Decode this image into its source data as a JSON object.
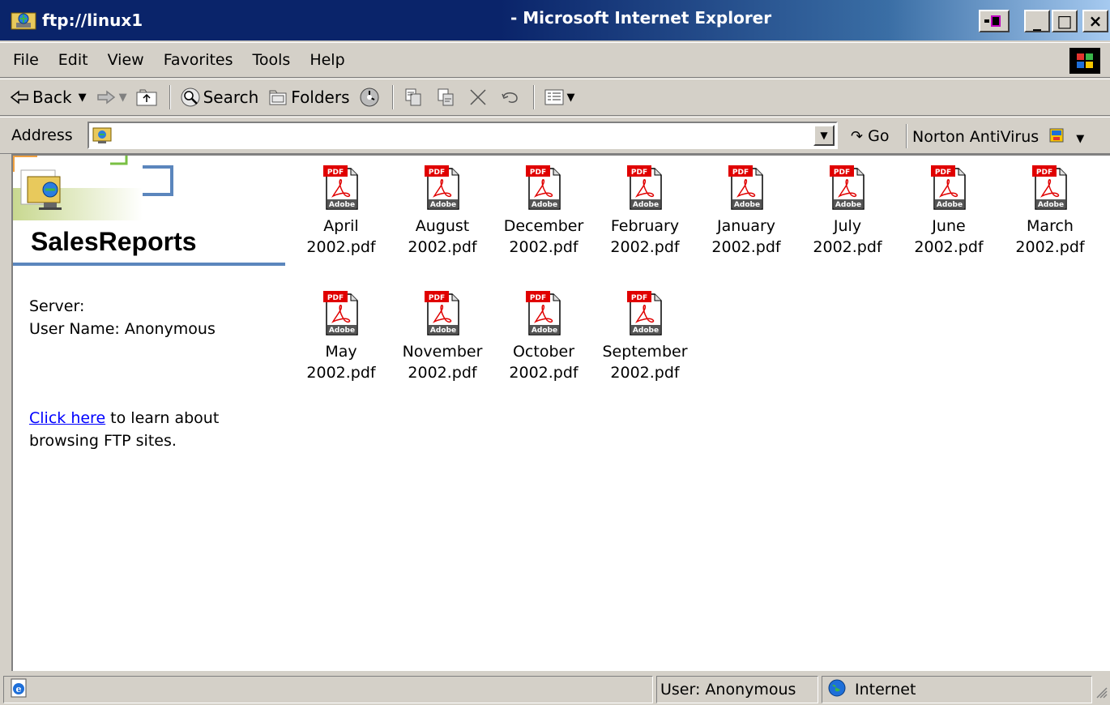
{
  "window": {
    "title_left": "ftp://linux1",
    "title_right": "- Microsoft Internet Explorer",
    "buttons": {
      "minimize": "_",
      "maximize": "□",
      "close": "×"
    }
  },
  "menu": [
    "File",
    "Edit",
    "View",
    "Favorites",
    "Tools",
    "Help"
  ],
  "toolbar": {
    "back": "Back",
    "search": "Search",
    "folders": "Folders"
  },
  "address": {
    "label": "Address",
    "value": "",
    "go": "Go",
    "norton": "Norton AntiVirus"
  },
  "left_pane": {
    "folder_title": "SalesReports",
    "server_label": "Server:",
    "user_label": "User Name: Anonymous",
    "link_text": "Click here",
    "link_rest": " to learn about browsing FTP sites."
  },
  "files": [
    {
      "line1": "April",
      "line2": "2002.pdf"
    },
    {
      "line1": "August",
      "line2": "2002.pdf"
    },
    {
      "line1": "December",
      "line2": "2002.pdf"
    },
    {
      "line1": "February",
      "line2": "2002.pdf"
    },
    {
      "line1": "January",
      "line2": "2002.pdf"
    },
    {
      "line1": "July",
      "line2": "2002.pdf"
    },
    {
      "line1": "June",
      "line2": "2002.pdf"
    },
    {
      "line1": "March",
      "line2": "2002.pdf"
    },
    {
      "line1": "May",
      "line2": "2002.pdf"
    },
    {
      "line1": "November",
      "line2": "2002.pdf"
    },
    {
      "line1": "October",
      "line2": "2002.pdf"
    },
    {
      "line1": "September",
      "line2": "2002.pdf"
    }
  ],
  "pdf_icon": {
    "badge": "PDF",
    "brand": "Adobe"
  },
  "status": {
    "user": "User: Anonymous",
    "zone": "Internet"
  }
}
